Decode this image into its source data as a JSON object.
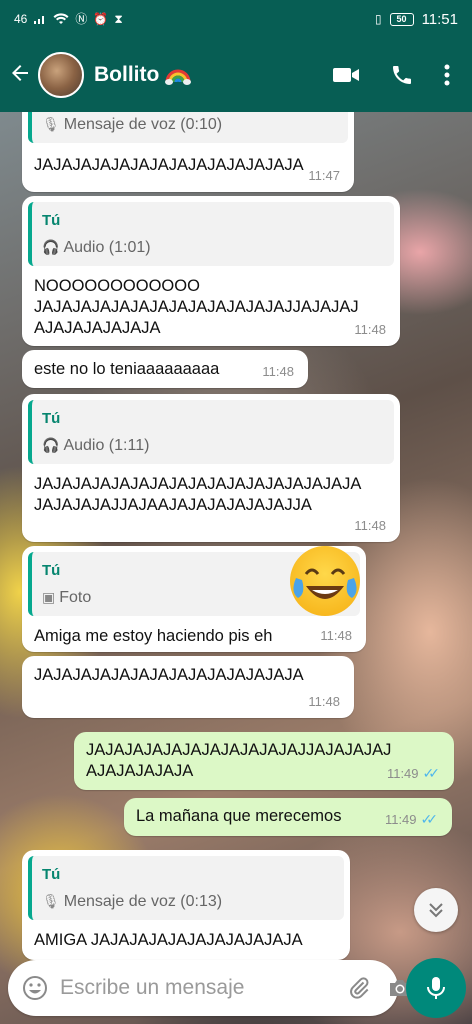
{
  "status_bar": {
    "network": "46",
    "battery_level": "50",
    "time": "11:51"
  },
  "header": {
    "contact_name": "Bollito",
    "back_icon": "arrow-left-icon",
    "video_icon": "video-call-icon",
    "call_icon": "phone-icon",
    "menu_icon": "more-vert-icon"
  },
  "messages": [
    {
      "direction": "in",
      "quote": {
        "author": "",
        "type_label": "Mensaje de voz (0:10)"
      },
      "text": "JAJAJAJAJAJAJAJAJAJAJAJAJAJA",
      "time": "11:47"
    },
    {
      "direction": "in",
      "quote": {
        "author": "Tú",
        "type_label": "Audio (1:01)"
      },
      "text": "NOOOOOOOOOOOO JAJAJAJAJAJAJAJAJAJAJAJAJAJJAJAJAJAJAJAJAJAJA",
      "text_lines": [
        "NOOOOOOOOOOOO",
        "JAJAJAJAJAJAJAJAJAJAJAJAJAJJAJAJAJ",
        "AJAJAJAJAJAJA"
      ],
      "time": "11:48"
    },
    {
      "direction": "in",
      "text": "este no lo teniaaaaaaaaa",
      "time": "11:48"
    },
    {
      "direction": "in",
      "quote": {
        "author": "Tú",
        "type_label": "Audio (1:11)"
      },
      "text_lines": [
        "JAJAJAJAJAJAJAJAJAJAJAJAJAJAJAJAJA",
        "JAJAJAJAJJAJAAJAJAJAJAJAJAJJA"
      ],
      "time": "11:48"
    },
    {
      "direction": "in",
      "quote": {
        "author": "Tú",
        "type_label": "Foto"
      },
      "text": "Amiga me estoy haciendo pis eh",
      "time": "11:48"
    },
    {
      "direction": "in",
      "text": "JAJAJAJAJAJAJAJAJAJAJAJAJAJA",
      "time": "11:48"
    },
    {
      "direction": "out",
      "text_lines": [
        "JAJAJAJAJAJAJAJAJAJAJAJJAJAJAJAJ",
        "AJAJAJAJAJA"
      ],
      "time": "11:49",
      "status": "read"
    },
    {
      "direction": "out",
      "text": "La mañana que merecemos",
      "time": "11:49",
      "status": "read"
    },
    {
      "direction": "in",
      "quote": {
        "author": "Tú",
        "type_label": "Mensaje de voz (0:13)"
      },
      "text": "AMIGA JAJAJAJAJAJAJAJAJAJAJA",
      "time": ""
    }
  ],
  "composer": {
    "placeholder": "Escribe un mensaje"
  },
  "colors": {
    "header_bg": "#075e54",
    "outgoing_bubble": "#dcf8c6",
    "quote_accent": "#06a88e",
    "read_ticks": "#4fb6ec",
    "mic_button": "#00897b"
  }
}
